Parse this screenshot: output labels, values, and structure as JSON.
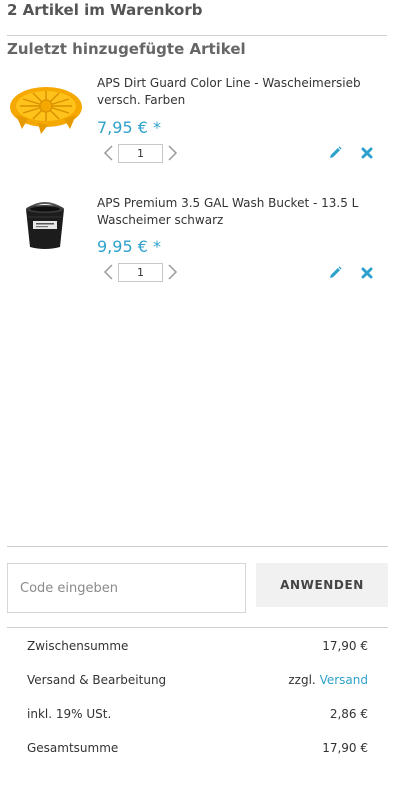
{
  "cart": {
    "title": "2 Artikel im Warenkorb"
  },
  "recent": {
    "title": "Zuletzt hinzugefügte Artikel"
  },
  "items": [
    {
      "name": "APS Dirt Guard Color Line - Wascheimersieb versch. Farben",
      "price": "7,95 € *",
      "quantity": "1",
      "image": "yellow-dirt-guard-grate"
    },
    {
      "name": "APS Premium 3.5 GAL Wash Bucket - 13.5 L Wascheimer schwarz",
      "price": "9,95 € *",
      "quantity": "1",
      "image": "black-wash-bucket"
    }
  ],
  "icons": {
    "prev": "chevron-left-icon",
    "next": "chevron-right-icon",
    "edit": "pencil-icon",
    "remove": "close-icon"
  },
  "coupon": {
    "placeholder": "Code eingeben",
    "apply_label": "ANWENDEN"
  },
  "summary": {
    "subtotal_label": "Zwischensumme",
    "subtotal_value": "17,90 €",
    "shipping_label": "Versand & Bearbeitung",
    "shipping_prefix": "zzgl.",
    "shipping_link": "Versand",
    "tax_label": "inkl. 19% USt.",
    "tax_value": "2,86 €",
    "total_label": "Gesamtsumme",
    "total_value": "17,90 €"
  },
  "colors": {
    "accent": "#2ea2cc",
    "divider": "#cfcfcf",
    "product_yellow": "#f5a800"
  }
}
